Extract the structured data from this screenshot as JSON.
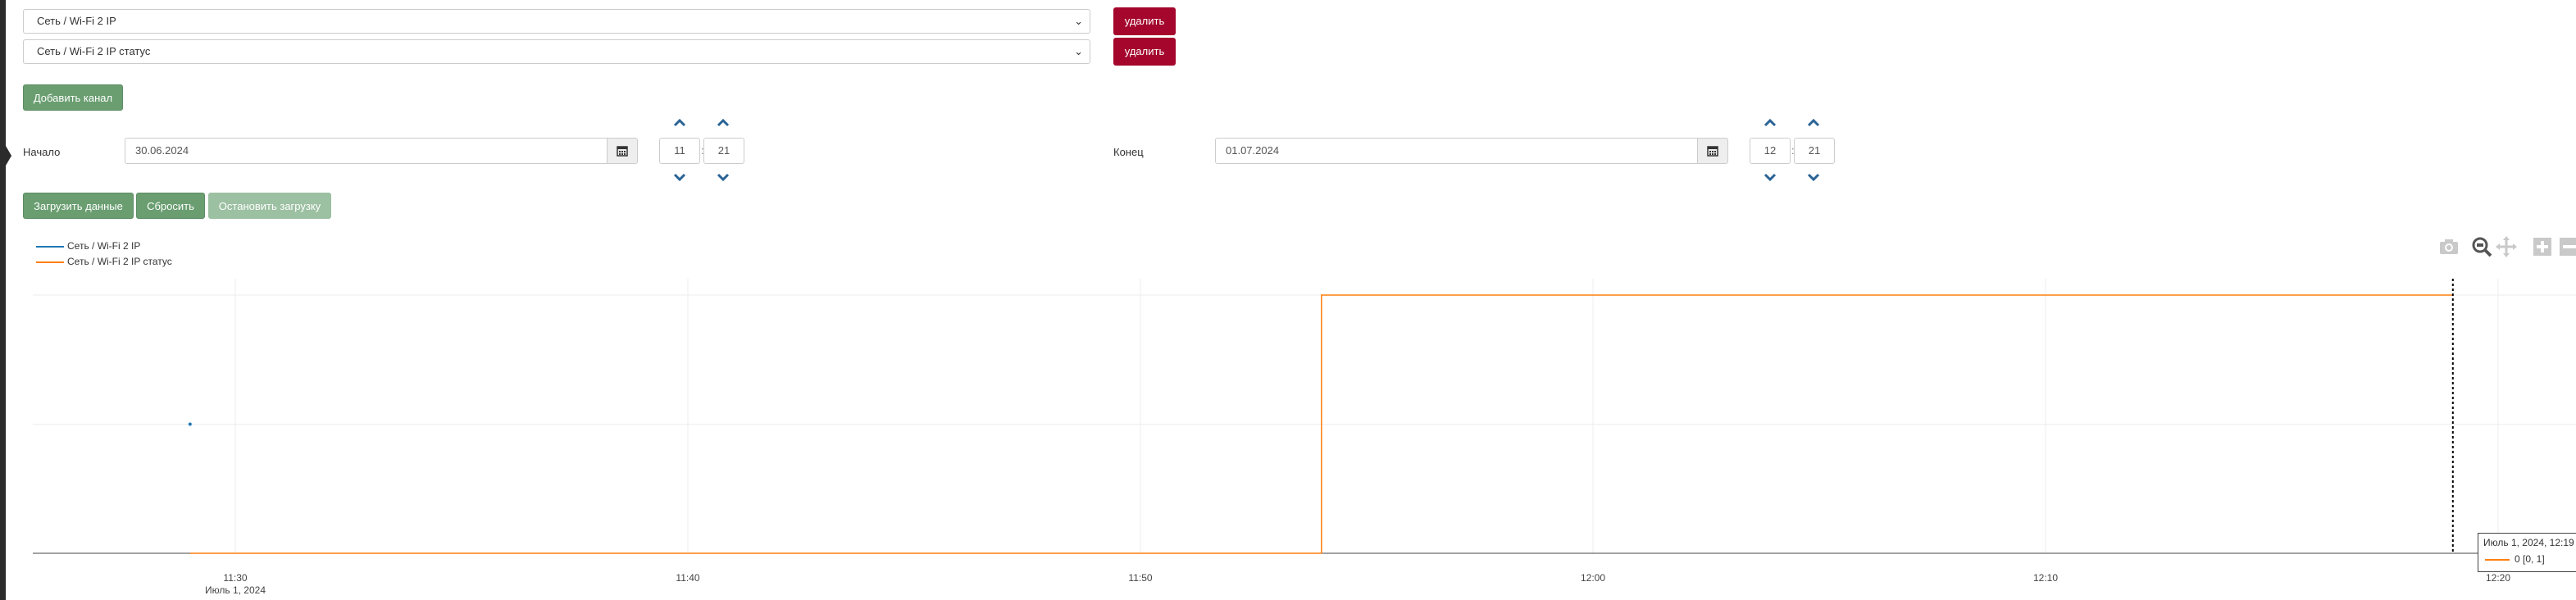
{
  "channels": [
    {
      "label": "Сеть / Wi-Fi 2 IP",
      "delete_label": "удалить"
    },
    {
      "label": "Сеть / Wi-Fi 2 IP статус",
      "delete_label": "удалить"
    }
  ],
  "add_channel_label": "Добавить канал",
  "range": {
    "start": {
      "label": "Начало",
      "date": "30.06.2024",
      "hour": "11",
      "minute": "21"
    },
    "end": {
      "label": "Конец",
      "date": "01.07.2024",
      "hour": "12",
      "minute": "21"
    },
    "separator": ":"
  },
  "actions": {
    "load": "Загрузить данные",
    "reset": "Сбросить",
    "stop": "Остановить загрузку"
  },
  "colors": {
    "danger": "#a4062c",
    "success": "#6a9e71",
    "success_disabled": "#9cc0a2",
    "series_ip": "#1f77b4",
    "series_status": "#ff7f0e"
  },
  "modebar": [
    "camera-icon",
    "zoom-icon",
    "pan-icon",
    "zoom-in-icon",
    "zoom-out-icon"
  ],
  "chart_data": {
    "type": "line",
    "x_axis": {
      "type": "time",
      "range": [
        "2024-07-01 11:26",
        "2024-07-01 12:21"
      ],
      "ticks": [
        "11:30",
        "11:40",
        "11:50",
        "12:00",
        "12:10",
        "12:20"
      ],
      "tick_values": [
        "2024-07-01 11:30",
        "2024-07-01 11:40",
        "2024-07-01 11:50",
        "2024-07-01 12:00",
        "2024-07-01 12:10",
        "2024-07-01 12:20"
      ],
      "date_label": "Июль 1, 2024"
    },
    "y_axis": {
      "range": [
        0,
        1
      ],
      "grid": true
    },
    "legend": {
      "position": "top-left"
    },
    "series": [
      {
        "name": "Сеть / Wi-Fi 2 IP",
        "color": "#1f77b4",
        "x": [
          "2024-07-01 11:29"
        ],
        "y": [
          0.5
        ]
      },
      {
        "name": "Сеть / Wi-Fi 2 IP статус",
        "color": "#ff7f0e",
        "x": [
          "2024-07-01 11:29",
          "2024-07-01 11:54",
          "2024-07-01 11:54",
          "2024-07-01 12:19"
        ],
        "y": [
          0,
          0,
          1,
          1
        ]
      }
    ],
    "hover": {
      "x": "2024-07-01 12:19",
      "title": "Июль 1, 2024, 12:19",
      "value_text": "0 [0, 1]"
    }
  }
}
